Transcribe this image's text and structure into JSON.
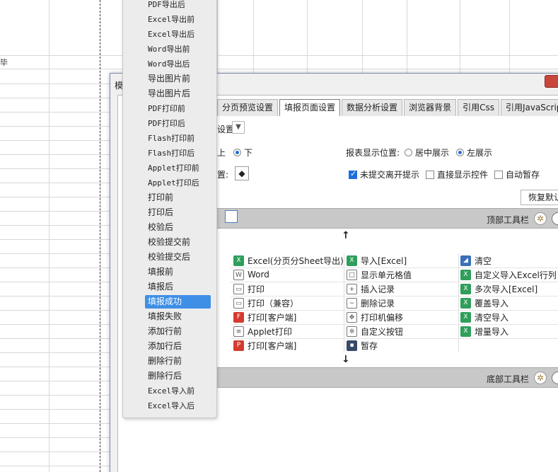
{
  "sheet": {
    "left_char": "毕"
  },
  "dialog": {
    "title_char": "模"
  },
  "tabs": [
    {
      "label": "分页预览设置",
      "active": false
    },
    {
      "label": "填报页面设置",
      "active": true
    },
    {
      "label": "数据分析设置",
      "active": false
    },
    {
      "label": "浏览器背景",
      "active": false
    },
    {
      "label": "引用Css",
      "active": false
    },
    {
      "label": "引用JavaScript",
      "active": false
    }
  ],
  "settings": {
    "mode_suffix": "设置",
    "position_top": "上",
    "position_bottom": "下",
    "position_bottom_selected": true,
    "display_label": "报表显示位置:",
    "display_center": "居中展示",
    "display_left": "左展示",
    "display_left_selected": true,
    "bg_suffix": "置:",
    "unsaved_prompt": "未提交离开提示",
    "unsaved_prompt_checked": true,
    "show_controls": "直接显示控件",
    "show_controls_checked": false,
    "auto_save": "自动暂存",
    "auto_save_checked": false,
    "restore_label": "恢复默认"
  },
  "toolbars": {
    "top_label": "顶部工具栏",
    "bottom_label": "底部工具栏"
  },
  "buttons": [
    {
      "label": "Excel(分页分Sheet导出)",
      "icon": "excel-icon",
      "col": 0,
      "row": 0
    },
    {
      "label": "Word",
      "icon": "word-icon",
      "col": 0,
      "row": 1
    },
    {
      "label": "打印",
      "icon": "printer-icon",
      "col": 0,
      "row": 2
    },
    {
      "label": "打印（兼容）",
      "icon": "printer-icon",
      "col": 0,
      "row": 3
    },
    {
      "label": "打印[客户端]",
      "icon": "flash-print-icon",
      "col": 0,
      "row": 4
    },
    {
      "label": "Applet打印",
      "icon": "applet-icon",
      "col": 0,
      "row": 5
    },
    {
      "label": "打印[客户端]",
      "icon": "pdf-print-icon",
      "col": 0,
      "row": 6
    },
    {
      "label": "导入[Excel]",
      "icon": "excel-import-icon",
      "col": 1,
      "row": 0
    },
    {
      "label": "显示单元格值",
      "icon": "cell-icon",
      "col": 1,
      "row": 1
    },
    {
      "label": "插入记录",
      "icon": "insert-row-icon",
      "col": 1,
      "row": 2
    },
    {
      "label": "删除记录",
      "icon": "delete-row-icon",
      "col": 1,
      "row": 3
    },
    {
      "label": "打印机偏移",
      "icon": "move-icon",
      "col": 1,
      "row": 4
    },
    {
      "label": "自定义按钮",
      "icon": "gear-icon",
      "col": 1,
      "row": 5
    },
    {
      "label": "暂存",
      "icon": "save-icon",
      "col": 1,
      "row": 6
    },
    {
      "label": "清空",
      "icon": "eraser-icon",
      "col": 2,
      "row": 0
    },
    {
      "label": "自定义导入Excel行列",
      "icon": "excel-import-icon",
      "col": 2,
      "row": 1
    },
    {
      "label": "多次导入[Excel]",
      "icon": "excel-import-icon",
      "col": 2,
      "row": 2
    },
    {
      "label": "覆盖导入",
      "icon": "excel-import-icon",
      "col": 2,
      "row": 3
    },
    {
      "label": "清空导入",
      "icon": "excel-import-icon",
      "col": 2,
      "row": 4
    },
    {
      "label": "增量导入",
      "icon": "excel-import-icon",
      "col": 2,
      "row": 5
    }
  ],
  "menu": {
    "items": [
      {
        "label": "PDF导出后",
        "selected": false
      },
      {
        "label": "Excel导出前",
        "selected": false
      },
      {
        "label": "Excel导出后",
        "selected": false
      },
      {
        "label": "Word导出前",
        "selected": false
      },
      {
        "label": "Word导出后",
        "selected": false
      },
      {
        "label": "导出图片前",
        "selected": false
      },
      {
        "label": "导出图片后",
        "selected": false
      },
      {
        "label": "PDF打印前",
        "selected": false
      },
      {
        "label": "PDF打印后",
        "selected": false
      },
      {
        "label": "Flash打印前",
        "selected": false
      },
      {
        "label": "Flash打印后",
        "selected": false
      },
      {
        "label": "Applet打印前",
        "selected": false
      },
      {
        "label": "Applet打印后",
        "selected": false
      },
      {
        "label": "打印前",
        "selected": false
      },
      {
        "label": "打印后",
        "selected": false
      },
      {
        "label": "校验后",
        "selected": false
      },
      {
        "label": "校验提交前",
        "selected": false
      },
      {
        "label": "校验提交后",
        "selected": false
      },
      {
        "label": "填报前",
        "selected": false
      },
      {
        "label": "填报后",
        "selected": false
      },
      {
        "label": "填报成功",
        "selected": true
      },
      {
        "label": "填报失败",
        "selected": false
      },
      {
        "label": "添加行前",
        "selected": false
      },
      {
        "label": "添加行后",
        "selected": false
      },
      {
        "label": "删除行前",
        "selected": false
      },
      {
        "label": "删除行后",
        "selected": false
      },
      {
        "label": "Excel导入前",
        "selected": false
      },
      {
        "label": "Excel导入后",
        "selected": false
      }
    ]
  },
  "colors": {
    "selection": "#3f8fe6",
    "close_button": "#c9463d",
    "toolbar_bar": "#c8c8c8"
  }
}
